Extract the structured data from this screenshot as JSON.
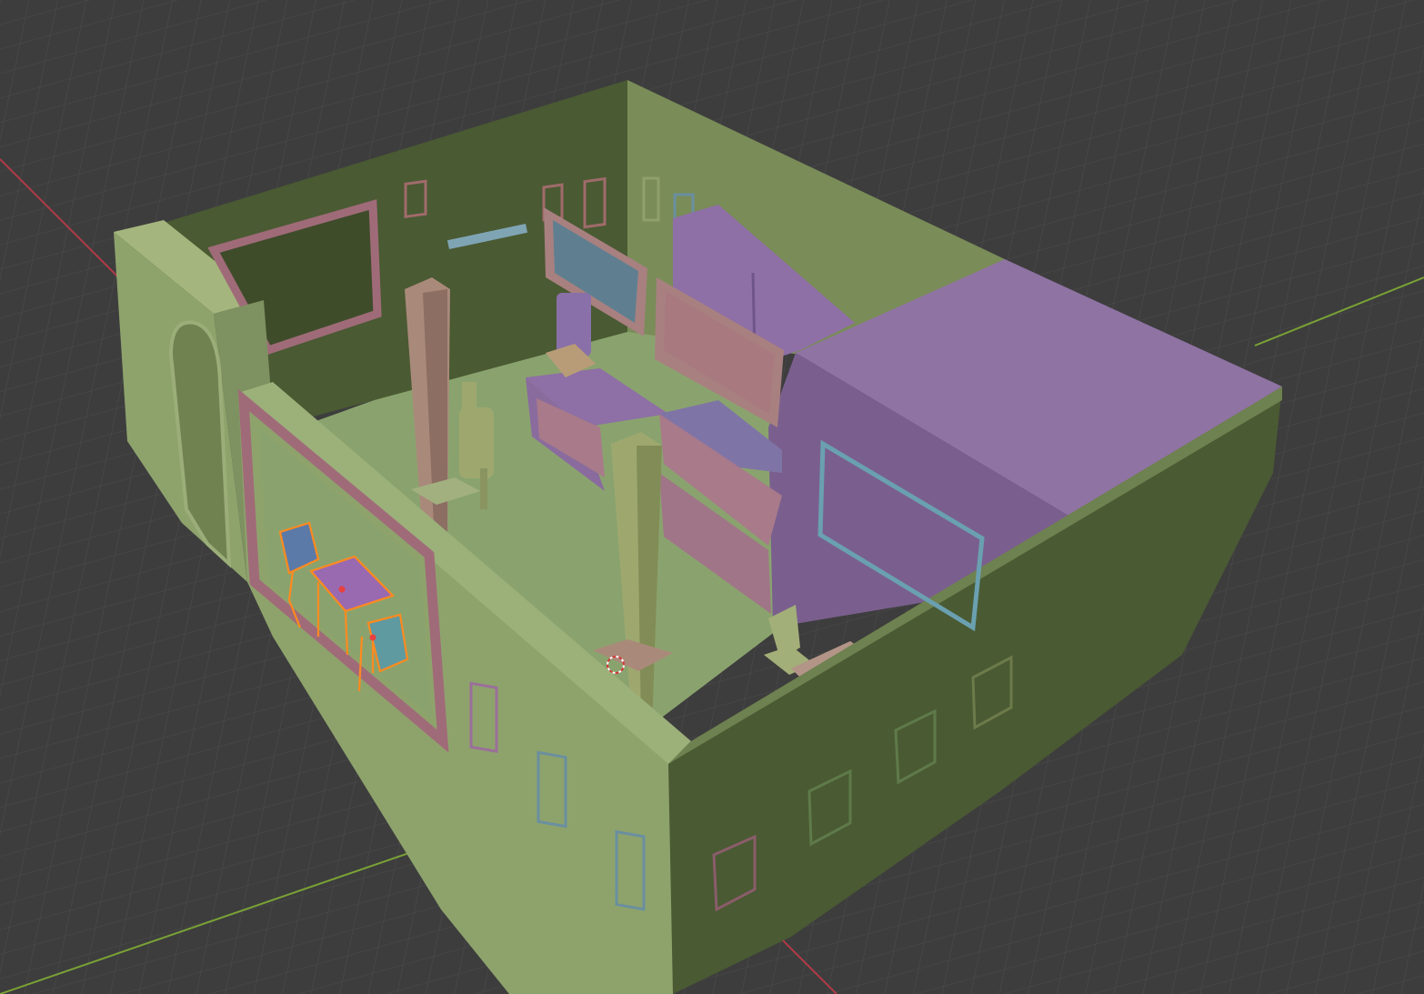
{
  "viewport": {
    "mode": "Solid",
    "shading": "random",
    "selected_objects": [
      "chair",
      "table",
      "chair"
    ],
    "colors": {
      "background": "#3d3d3d",
      "grid": "#4a4a4a",
      "x_axis": "#b03a48",
      "y_axis": "#7aa235",
      "selection": "#ff8a1f",
      "wall_green": "#8ea36c",
      "wall_purple": "#9a72a6",
      "floor": "#8aa36e"
    }
  }
}
